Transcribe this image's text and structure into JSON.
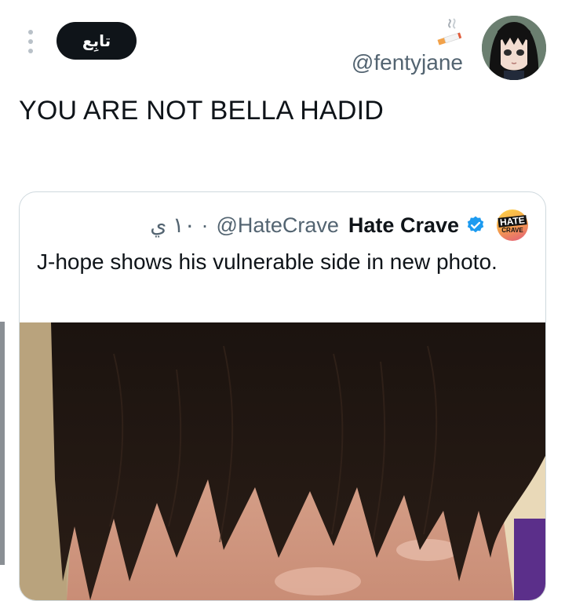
{
  "header": {
    "follow_label": "تابِع",
    "handle": "@fentyjane",
    "name_emoji": "cigarette-emoji"
  },
  "tweet": {
    "text": "YOU ARE NOT BELLA HADID"
  },
  "quote": {
    "name": "Hate Crave",
    "handle": "@HateCrave",
    "time": "١٠ ي ·",
    "verified": true,
    "avatar_top": "HATE",
    "avatar_bottom": "CRAVE",
    "text": "J-hope shows his vulnerable side in new photo."
  },
  "colors": {
    "follow_button_bg": "#0f1419",
    "secondary_text": "#536471",
    "verified_blue": "#1d9bf0",
    "card_border": "#cfd9de"
  }
}
